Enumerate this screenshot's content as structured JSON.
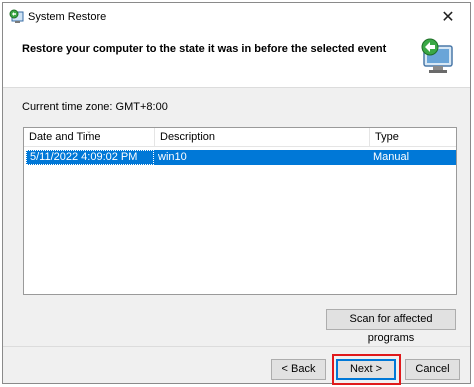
{
  "window": {
    "title": "System Restore",
    "close_glyph": "✕"
  },
  "header": {
    "text": "Restore your computer to the state it was in before the selected event"
  },
  "timezone": {
    "text": "Current time zone: GMT+8:00"
  },
  "restore_list": {
    "columns": [
      "Date and Time",
      "Description",
      "Type"
    ],
    "sort_glyph": "⌄",
    "rows": [
      {
        "date": "5/11/2022 4:09:02 PM",
        "description": "win10",
        "type": "Manual",
        "selected": true
      }
    ]
  },
  "buttons": {
    "scan": "Scan for affected programs",
    "back": "< Back",
    "next": "Next >",
    "cancel": "Cancel"
  },
  "colors": {
    "selection": "#0078d7",
    "highlight_box": "#e0191b"
  },
  "icons": {
    "title": "system-restore-icon",
    "header": "restore-computer-icon",
    "close": "close-icon"
  }
}
